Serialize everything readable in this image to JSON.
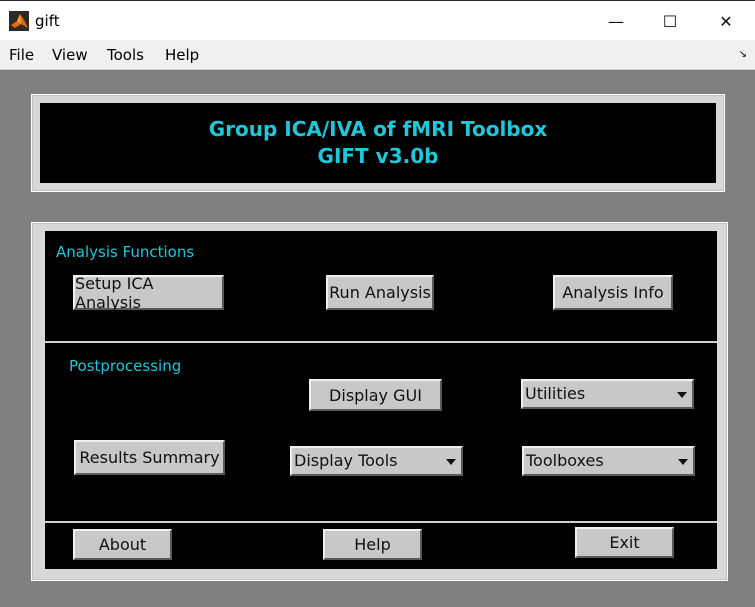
{
  "window": {
    "title": "gift",
    "minimize_glyph": "—",
    "maximize_glyph": "☐",
    "close_glyph": "✕"
  },
  "menubar": {
    "items": [
      "File",
      "View",
      "Tools",
      "Help"
    ],
    "dock_glyph": "↘"
  },
  "banner": {
    "line1": "Group ICA/IVA of fMRI Toolbox",
    "line2": "GIFT v3.0b"
  },
  "analysis": {
    "label": "Analysis Functions",
    "setup_label": "Setup ICA Analysis",
    "run_label": "Run Analysis",
    "info_label": "Analysis Info"
  },
  "postprocessing": {
    "label": "Postprocessing",
    "display_gui_label": "Display GUI",
    "utilities_value": "Utilities",
    "results_summary_label": "Results Summary",
    "display_tools_value": "Display Tools",
    "toolboxes_value": "Toolboxes"
  },
  "footer": {
    "about_label": "About",
    "help_label": "Help",
    "exit_label": "Exit"
  },
  "colors": {
    "accent_text": "#1ec8d8",
    "panel_background": "#000000",
    "window_background": "#808080"
  }
}
